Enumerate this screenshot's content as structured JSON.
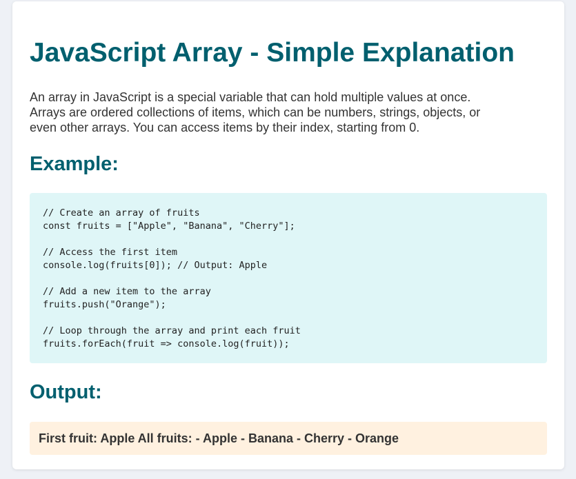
{
  "page": {
    "title": "JavaScript Array - Simple Explanation",
    "intro_lines": [
      "An array in JavaScript is a special variable that can hold multiple values at once.",
      "Arrays are ordered collections of items, which can be numbers, strings, objects, or",
      "even other arrays. You can access items by their index, starting from 0."
    ]
  },
  "example": {
    "heading": "Example:",
    "code_lines": [
      "// Create an array of fruits",
      "const fruits = [\"Apple\", \"Banana\", \"Cherry\"];",
      "",
      "// Access the first item",
      "console.log(fruits[0]); // Output: Apple",
      "",
      "// Add a new item to the array",
      "fruits.push(\"Orange\");",
      "",
      "// Loop through the array and print each fruit",
      "fruits.forEach(fruit => console.log(fruit));"
    ]
  },
  "output": {
    "heading": "Output:",
    "text": "First fruit: Apple All fruits: - Apple - Banana - Cherry - Orange"
  },
  "colors": {
    "heading": "#005f6e",
    "code_background": "#dff6f7",
    "output_background": "#fff1e0",
    "page_background": "#eef1f6"
  }
}
